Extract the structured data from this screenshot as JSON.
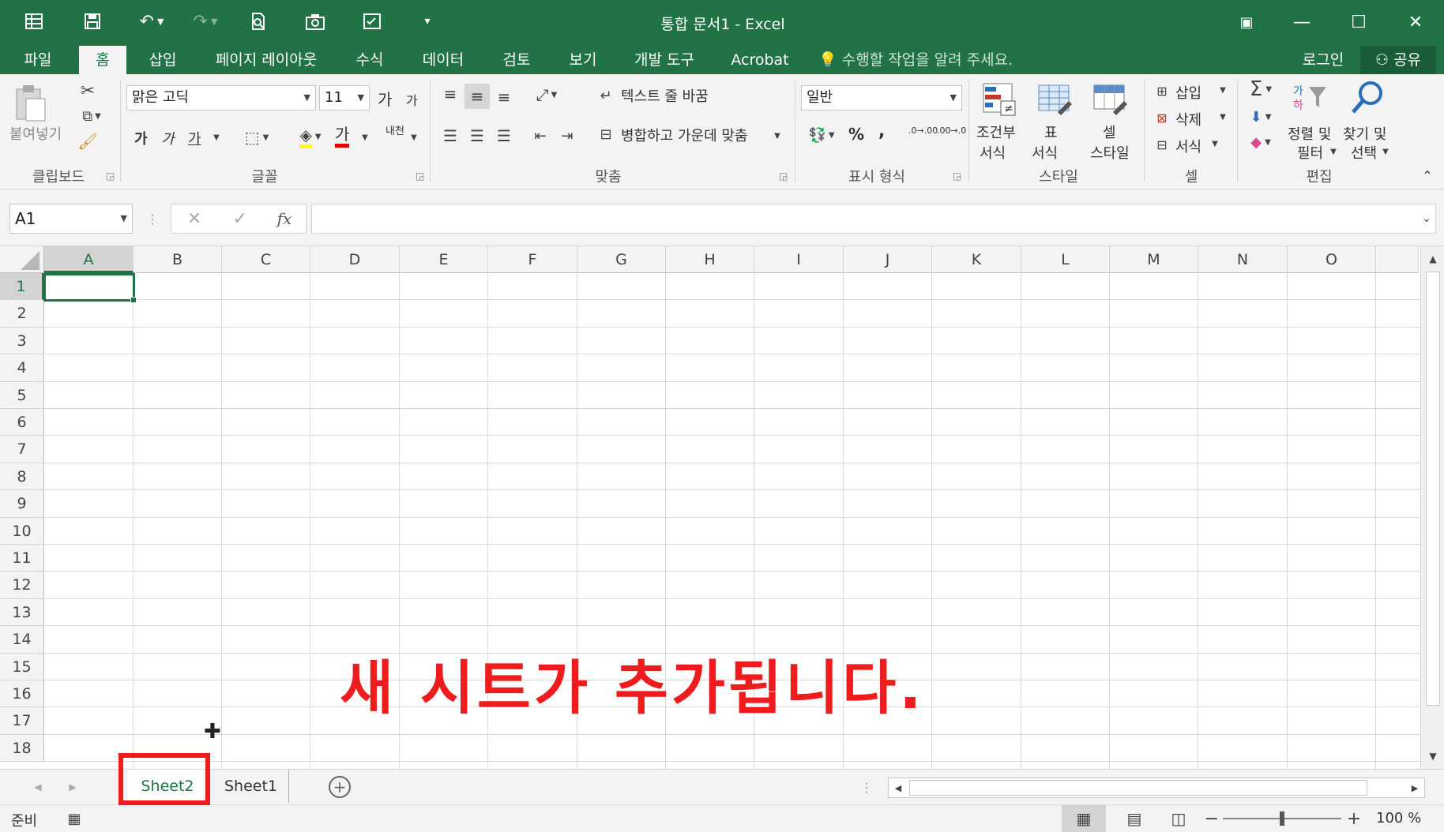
{
  "window": {
    "title": "통합 문서1 - Excel",
    "brand_color": "#217346",
    "accent_color": "#ee1c1c",
    "quick_access": [
      "grid-icon",
      "save-icon",
      "undo-icon",
      "redo-icon",
      "print-preview-icon",
      "camera-icon",
      "form-icon",
      "customize-icon"
    ],
    "controls": {
      "ribbon_display": "▣",
      "minimize": "—",
      "maximize": "☐",
      "close": "✕"
    }
  },
  "ribbon_tabs": [
    "파일",
    "홈",
    "삽입",
    "페이지 레이아웃",
    "수식",
    "데이터",
    "검토",
    "보기",
    "개발 도구",
    "Acrobat"
  ],
  "active_tab": "홈",
  "tell_me": "수행할 작업을 알려 주세요.",
  "account": {
    "login": "로그인",
    "share": "공유"
  },
  "ribbon": {
    "clipboard": {
      "label": "클립보드",
      "paste": "붙여넣기"
    },
    "font": {
      "label": "글꼴",
      "font_name": "맑은 고딕",
      "font_size": "11",
      "grow": "가",
      "shrink": "가",
      "bold": "가",
      "italic": "가",
      "underline": "가",
      "font_color": "가",
      "phonetic": "내천"
    },
    "alignment": {
      "label": "맞춤",
      "wrap_text": "텍스트 줄 바꿈",
      "merge_center": "병합하고 가운데 맞춤"
    },
    "number": {
      "label": "표시 형식",
      "format": "일반",
      "percent": "%",
      "comma": ",",
      "inc_decimal": ".0→.00",
      "dec_decimal": ".00→.0"
    },
    "styles": {
      "label": "스타일",
      "conditional_1": "조건부",
      "conditional_2": "서식",
      "table_1": "표",
      "table_2": "서식",
      "cell_1": "셀",
      "cell_2": "스타일"
    },
    "cells": {
      "label": "셀",
      "insert": "삽입",
      "delete": "삭제",
      "format": "서식"
    },
    "editing": {
      "label": "편집",
      "sort_1": "정렬 및",
      "sort_2": "필터",
      "find_1": "찾기 및",
      "find_2": "선택"
    }
  },
  "formula_bar": {
    "name_box": "A1",
    "cancel": "✕",
    "enter": "✓",
    "fx": "fx",
    "formula": ""
  },
  "columns": [
    "A",
    "B",
    "C",
    "D",
    "E",
    "F",
    "G",
    "H",
    "I",
    "J",
    "K",
    "L",
    "M",
    "N",
    "O"
  ],
  "rows": [
    "1",
    "2",
    "3",
    "4",
    "5",
    "6",
    "7",
    "8",
    "9",
    "10",
    "11",
    "12",
    "13",
    "14",
    "15",
    "16",
    "17",
    "18"
  ],
  "selected_cell": "A1",
  "sheets": {
    "tabs": [
      "Sheet2",
      "Sheet1"
    ],
    "active": "Sheet2",
    "add": "+"
  },
  "status": {
    "ready": "준비",
    "zoom": "100 %",
    "zoom_level": 100
  },
  "annotation": "새 시트가 추가됩니다."
}
